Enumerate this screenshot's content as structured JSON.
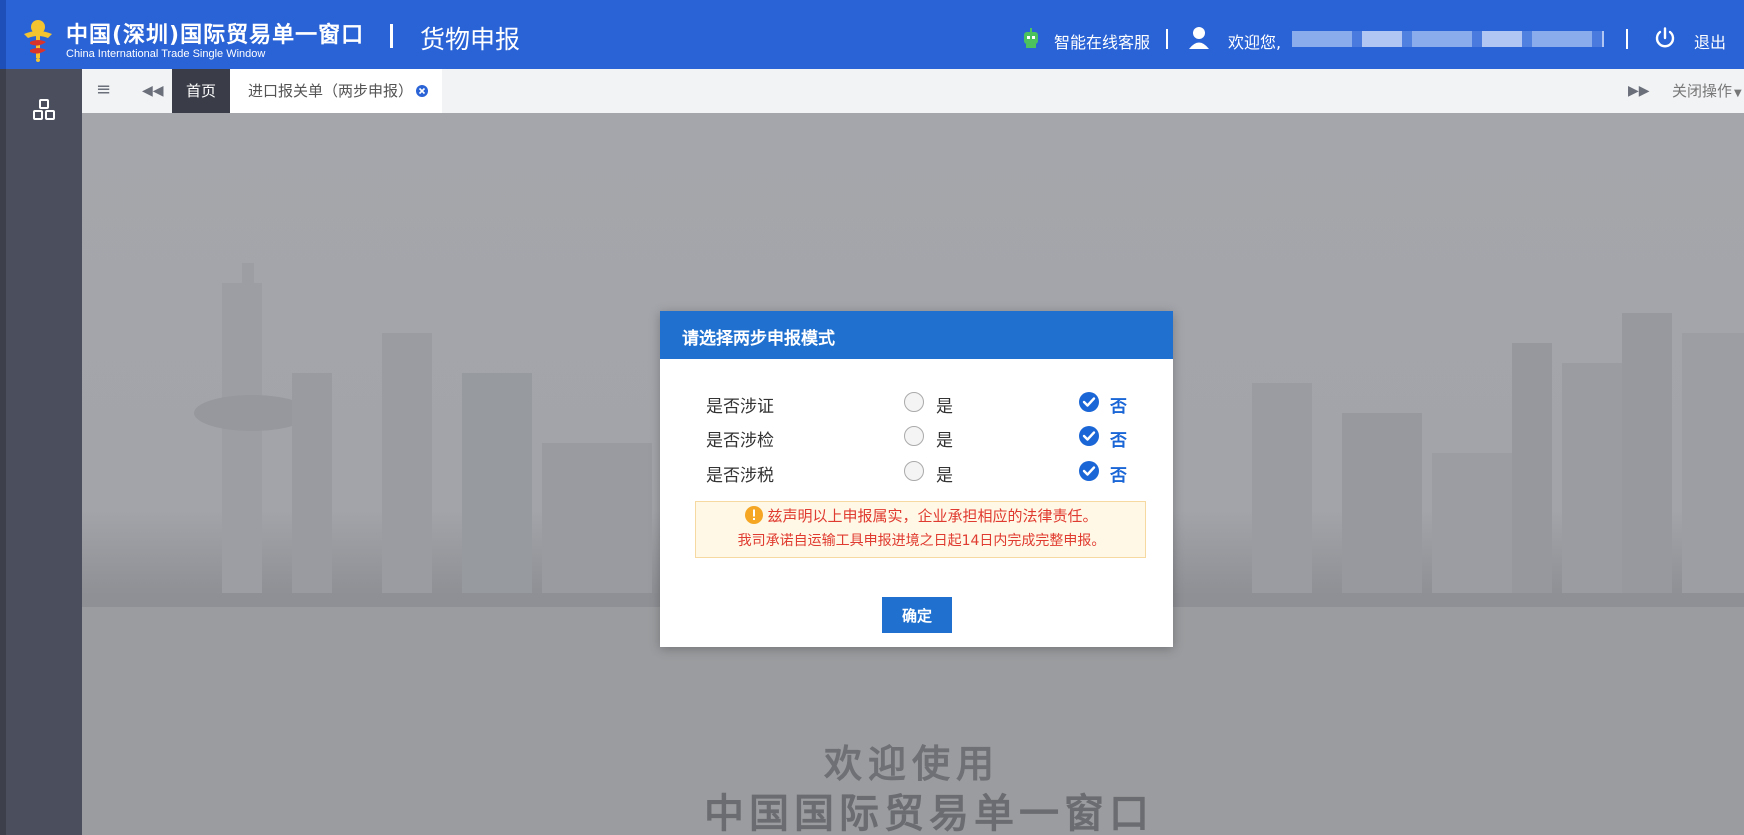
{
  "header": {
    "brand_cn": "中国(深圳)国际贸易单一窗口",
    "brand_en": "China International Trade Single Window",
    "module_title": "货物申报",
    "service_label": "智能在线客服",
    "divider": "|",
    "welcome_label": "欢迎您,",
    "logout_label": "退出"
  },
  "tabbar": {
    "home_label": "首页",
    "active_tab_label": "进口报关单（两步申报）",
    "close_ops_label": "关闭操作"
  },
  "background": {
    "welcome_line1": "欢迎使用",
    "welcome_line2": "中国国际贸易单一窗口"
  },
  "modal": {
    "title": "请选择两步申报模式",
    "questions": [
      {
        "label": "是否涉证",
        "yes": "是",
        "no": "否",
        "selected": "no"
      },
      {
        "label": "是否涉检",
        "yes": "是",
        "no": "否",
        "selected": "no"
      },
      {
        "label": "是否涉税",
        "yes": "是",
        "no": "否",
        "selected": "no"
      }
    ],
    "notice_line1": "兹声明以上申报属实，企业承担相应的法律责任。",
    "notice_line2": "我司承诺自运输工具申报进境之日起14日内完成完整申报。",
    "confirm_label": "确定"
  },
  "colors": {
    "header_bg": "#2a63d6",
    "sidebar_bg": "#4b4e5c",
    "modal_header_bg": "#1f70cf",
    "notice_text": "#e03b30",
    "selected_radio": "#1a66d6"
  }
}
